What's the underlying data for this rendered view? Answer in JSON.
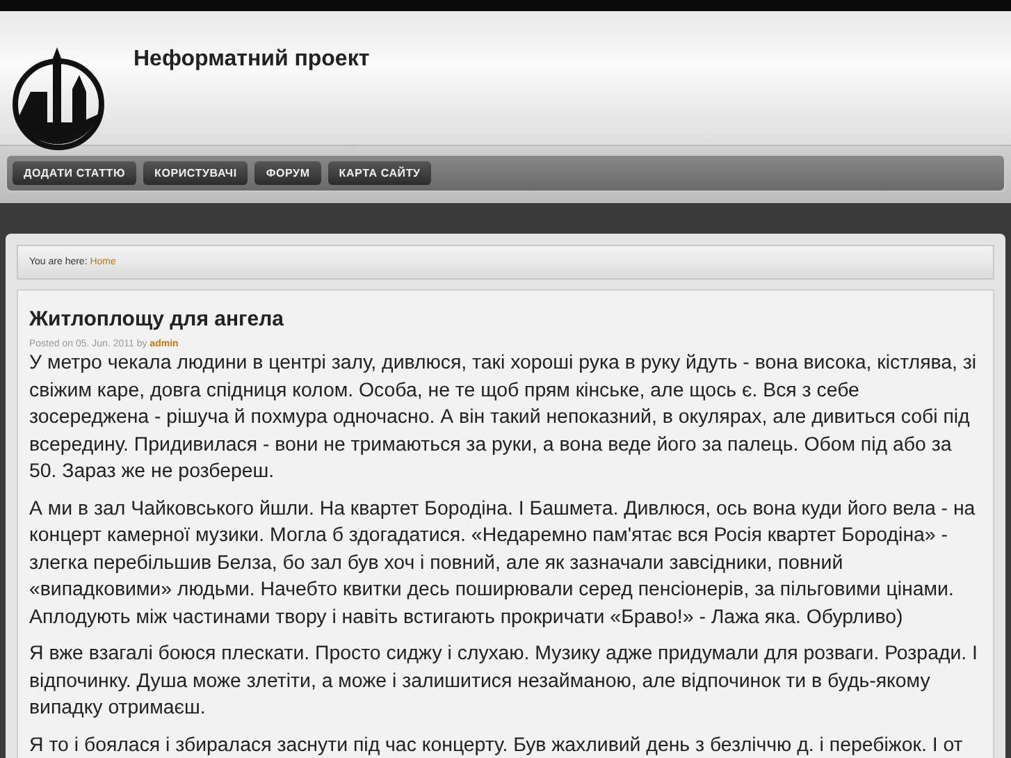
{
  "site": {
    "title": "Неформатний проект"
  },
  "nav": [
    {
      "label": "ДОДАТИ СТАТТЮ"
    },
    {
      "label": "КОРИСТУВАЧІ"
    },
    {
      "label": "ФОРУМ"
    },
    {
      "label": "КАРТА САЙТУ"
    }
  ],
  "breadcrumb": {
    "prefix": "You are here:",
    "link": "Home"
  },
  "article": {
    "title": "Житлоплощу для ангела",
    "posted": "Posted on 05. Jun. 2011 by",
    "author": "admin",
    "paragraphs": [
      "У метро чекала людини в центрі залу, дивлюся, такі хороші рука в руку йдуть - вона висока, кістлява, зі свіжим каре, довга спідниця колом. Особа, не те щоб прям кінське, але щось є. Вся з себе зосереджена - рішуча й похмура одночасно. А він такий непоказний, в окулярах, але дивиться собі під всередину. Придивилася - вони не тримаються за руки, а вона веде його за палець. Обом під або за 50. Зараз же не розбереш.",
      "А ми в зал Чайковського йшли. На квартет Бородіна. І Башмета. Дивлюся, ось вона куди його вела - на концерт камерної музики. Могла б здогадатися. «Недаремно пам'ятає вся Росія квартет Бородіна» - злегка перебільшив Белза, бо зал був хоч і повний, але як зазначали завсідники, повний «випадковими» людьми. Начебто квитки десь поширювали серед пенсіонерів, за пільговими цінами. Аплодують між частинами твору і навіть встигають прокричати «Браво!» - Лажа яка. Обурливо)",
      "Я вже взагалі боюся плескати. Просто сиджу і слухаю. Музику адже придумали для розваги. Розради. І відпочинку. Душа може злетіти, а може і залишитися незайманою, але відпочинок ти в будь-якому випадку отримаєш.",
      "Я то і боялася і збиралася заснути під час концерту. Був жахливий день з безліччю д. і перебіжок. І от"
    ]
  }
}
